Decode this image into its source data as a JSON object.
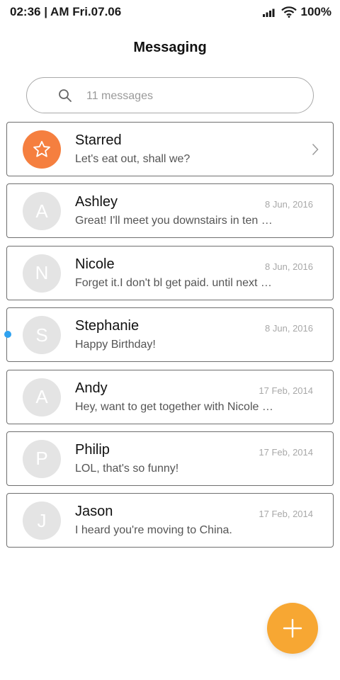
{
  "status_bar": {
    "time": "02:36 | AM Fri.07.06",
    "battery": "100%"
  },
  "header": {
    "title": "Messaging"
  },
  "search": {
    "placeholder": "11 messages"
  },
  "conversations": [
    {
      "name": "Starred",
      "preview": "Let's eat out, shall we?",
      "date": "",
      "initial": "",
      "starred": true
    },
    {
      "name": "Ashley",
      "preview": "Great! I'll meet you downstairs in ten …",
      "date": "8 Jun, 2016",
      "initial": "A"
    },
    {
      "name": "Nicole",
      "preview": "Forget it.I don't bl get paid. until next F…",
      "date": "8 Jun, 2016",
      "initial": "N"
    },
    {
      "name": "Stephanie",
      "preview": "Happy Birthday!",
      "date": "8 Jun, 2016",
      "initial": "S",
      "unread": true
    },
    {
      "name": "Andy",
      "preview": "Hey, want to get together with Nicole …",
      "date": "17 Feb, 2014",
      "initial": "A"
    },
    {
      "name": "Philip",
      "preview": "LOL, that's so funny!",
      "date": "17 Feb, 2014",
      "initial": "P"
    },
    {
      "name": "Jason",
      "preview": "I heard you're moving to China.",
      "date": "17 Feb, 2014",
      "initial": "J"
    }
  ],
  "colors": {
    "starred_avatar": "#f57f3f",
    "default_avatar": "#e4e4e4",
    "unread_dot": "#2fa2f0",
    "fab": "#f7a733"
  },
  "icons": {
    "search": "search-icon",
    "starred": "star-icon",
    "chevron": "chevron-right-icon",
    "fab": "plus-icon",
    "signal": "signal-icon",
    "wifi": "wifi-icon"
  }
}
